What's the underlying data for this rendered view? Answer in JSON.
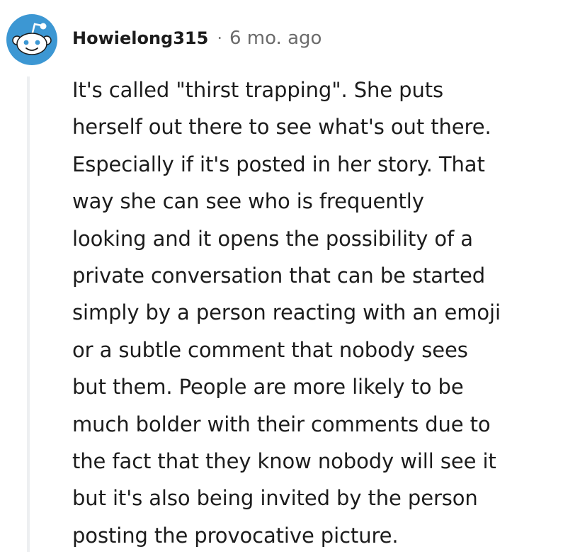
{
  "comment": {
    "author": "Howielong315",
    "separator": "·",
    "timestamp": "6 mo. ago",
    "avatar_icon": "reddit-snoo-avatar-icon",
    "body": "It's called \"thirst trapping\". She puts\nherself out there to see what's out there.\nEspecially if it's posted in her story. That\nway she can see who is frequently\nlooking and it opens the possibility of a\nprivate conversation that can be started\nsimply by a person reacting with an emoji\nor a subtle comment that nobody sees\nbut them. People are more likely to be\nmuch bolder with their comments due to\nthe fact that they know nobody will see it\nbut it's also being invited by the person\nposting the provocative picture."
  },
  "colors": {
    "avatar_background": "#3c97d3",
    "thread_line": "#edeff1",
    "text": "#1c1c1c",
    "meta_text": "#6b6b6b"
  }
}
